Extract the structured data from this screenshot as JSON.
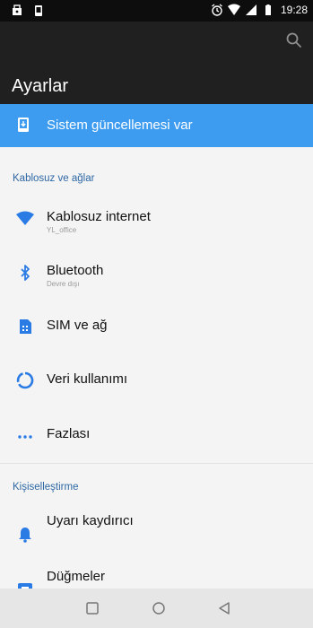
{
  "status_bar": {
    "time": "19:28",
    "left_icons": [
      "store-notification-icon",
      "download-notification-icon"
    ],
    "right_icons": [
      "alarm-icon",
      "wifi-icon",
      "signal-icon",
      "battery-icon"
    ]
  },
  "app_bar": {
    "title": "Ayarlar",
    "search_icon": "search-icon"
  },
  "banner": {
    "label": "Sistem güncellemesi var",
    "icon": "system-update-icon",
    "color": "#3d9cf0"
  },
  "sections": [
    {
      "header": "Kablosuz ve ağlar",
      "items": [
        {
          "title": "Kablosuz internet",
          "subtitle": "YL_office",
          "icon": "wifi-icon"
        },
        {
          "title": "Bluetooth",
          "subtitle": "Devre dışı",
          "icon": "bluetooth-icon"
        },
        {
          "title": "SIM ve ağ",
          "subtitle": "",
          "icon": "sim-card-icon"
        },
        {
          "title": "Veri kullanımı",
          "subtitle": "",
          "icon": "data-usage-icon"
        },
        {
          "title": "Fazlası",
          "subtitle": "",
          "icon": "more-icon"
        }
      ]
    },
    {
      "header": "Kişiselleştirme",
      "items": [
        {
          "title": "Uyarı kaydırıcı",
          "subtitle": "",
          "icon": "notification-bell-icon"
        },
        {
          "title": "Düğmeler",
          "subtitle": "",
          "icon": "buttons-icon"
        }
      ]
    }
  ],
  "nav_bar": {
    "buttons": [
      "recents-icon",
      "home-icon",
      "back-icon"
    ]
  },
  "colors": {
    "accent": "#3d9cf0",
    "section_header": "#2d67a4",
    "toolbar": "#202020",
    "status_bar": "#0d0d0d",
    "background": "#f4f4f4"
  }
}
